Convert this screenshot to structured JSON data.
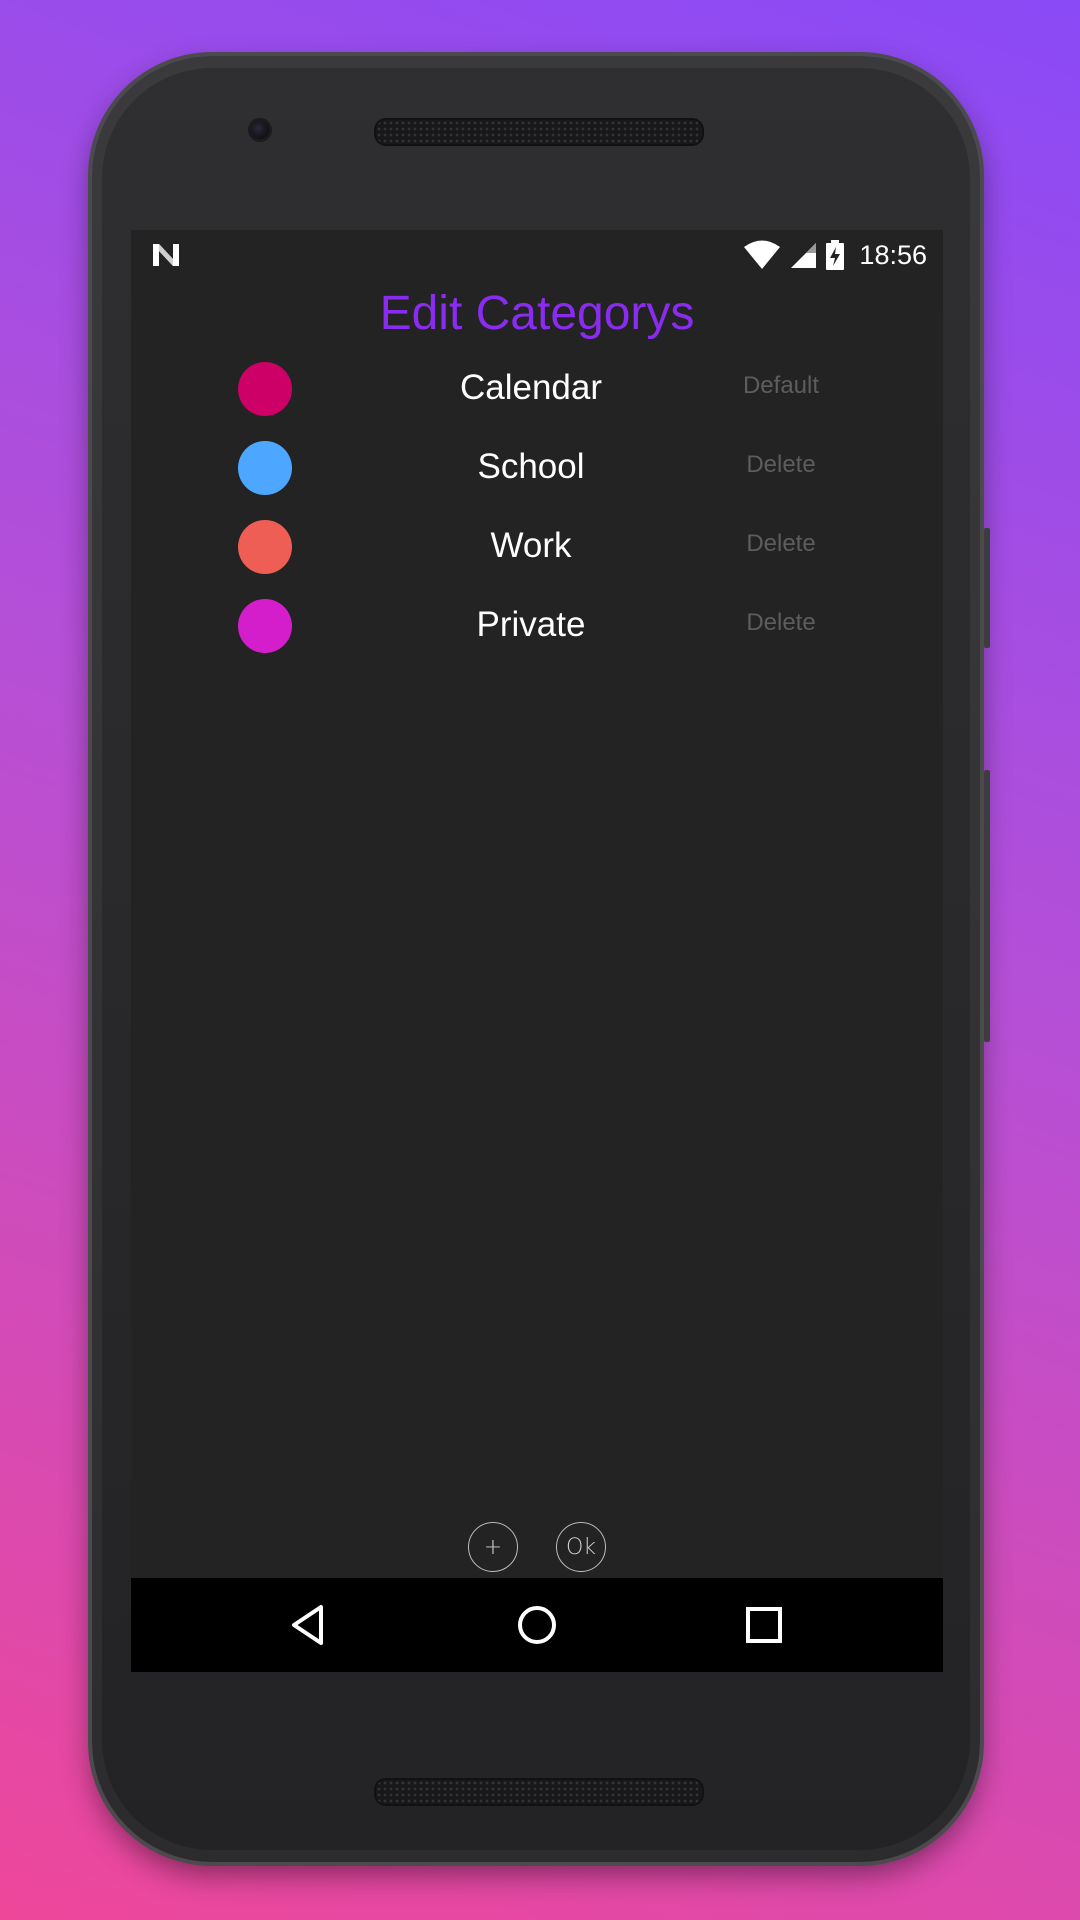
{
  "status_bar": {
    "time": "18:56",
    "notification_icon": "n-icon",
    "icons": [
      "wifi-icon",
      "signal-icon",
      "battery-charging-icon"
    ]
  },
  "screen": {
    "title": "Edit Categorys",
    "title_color": "#8a2cf0"
  },
  "categories": [
    {
      "name": "Calendar",
      "color": "#cc0066",
      "action": "Default"
    },
    {
      "name": "School",
      "color": "#4da6ff",
      "action": "Delete"
    },
    {
      "name": "Work",
      "color": "#ee5e55",
      "action": "Delete"
    },
    {
      "name": "Private",
      "color": "#d41ecc",
      "action": "Delete"
    }
  ],
  "bottom_actions": {
    "add_label": "+",
    "ok_label": "Ok"
  },
  "nav_bar": {
    "icons": [
      "back-icon",
      "home-icon",
      "recent-apps-icon"
    ]
  }
}
